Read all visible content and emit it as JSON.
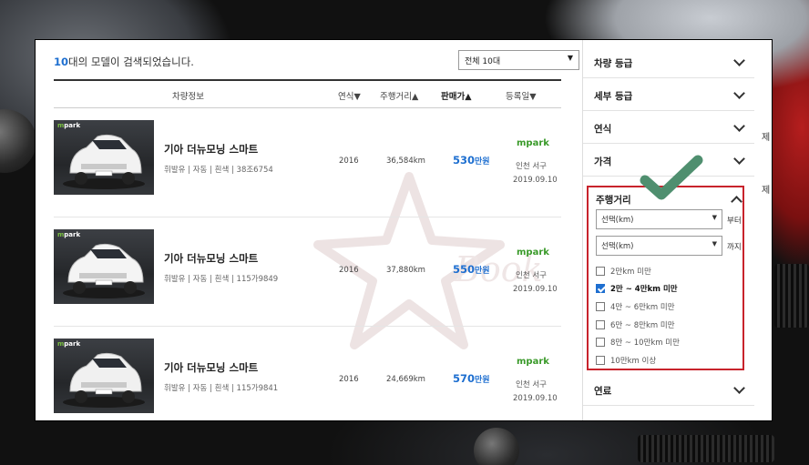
{
  "summary": {
    "count": "10",
    "text": "대의 모델이 검색되었습니다."
  },
  "sort_select": {
    "value": "전체 10대"
  },
  "columns": {
    "info": "차량정보",
    "year": "연식▼",
    "mileage": "주행거리▲",
    "price": "판매가▲",
    "date": "등록일▼"
  },
  "thumb_brand": {
    "m": "m",
    "park": "park"
  },
  "rows": [
    {
      "name": "기아 더뉴모닝 스마트",
      "spec": "휘발유 | 자동 | 흰색 | 38조6754",
      "year": "2016",
      "mileage": "36,584km",
      "price": "530",
      "unit": "만원",
      "dealer": "mpark",
      "location": "인천 서구",
      "date": "2019.09.10"
    },
    {
      "name": "기아 더뉴모닝 스마트",
      "spec": "휘발유 | 자동 | 흰색 | 115가9849",
      "year": "2016",
      "mileage": "37,880km",
      "price": "550",
      "unit": "만원",
      "dealer": "mpark",
      "location": "인천 서구",
      "date": "2019.09.10"
    },
    {
      "name": "기아 더뉴모닝 스마트",
      "spec": "휘발유 | 자동 | 흰색 | 115가9841",
      "year": "2016",
      "mileage": "24,669km",
      "price": "570",
      "unit": "만원",
      "dealer": "mpark",
      "location": "인천 서구",
      "date": "2019.09.10"
    }
  ],
  "filters": {
    "grade": "차량 등급",
    "sub_grade": "세부 등급",
    "year": "연식",
    "price": "가격",
    "mileage": "주행거리",
    "fuel": "연료"
  },
  "mileage_filter": {
    "from_placeholder": "선택(km)",
    "from_suffix": "부터",
    "to_placeholder": "선택(km)",
    "to_suffix": "까지",
    "options": [
      {
        "label": "2만km 미만",
        "checked": false
      },
      {
        "label": "2만 ~ 4만km 미만",
        "checked": true
      },
      {
        "label": "4만 ~ 6만km 미만",
        "checked": false
      },
      {
        "label": "6만 ~ 8만km 미만",
        "checked": false
      },
      {
        "label": "8만 ~ 10만km 미만",
        "checked": false
      },
      {
        "label": "10만km 이상",
        "checked": false
      }
    ]
  },
  "side_chars": {
    "a": "제",
    "b": "제"
  },
  "colors": {
    "accent": "#1e6fd0",
    "highlight": "#c8232c",
    "check": "#4f8f6f",
    "dealer": "#3a9a2a"
  }
}
